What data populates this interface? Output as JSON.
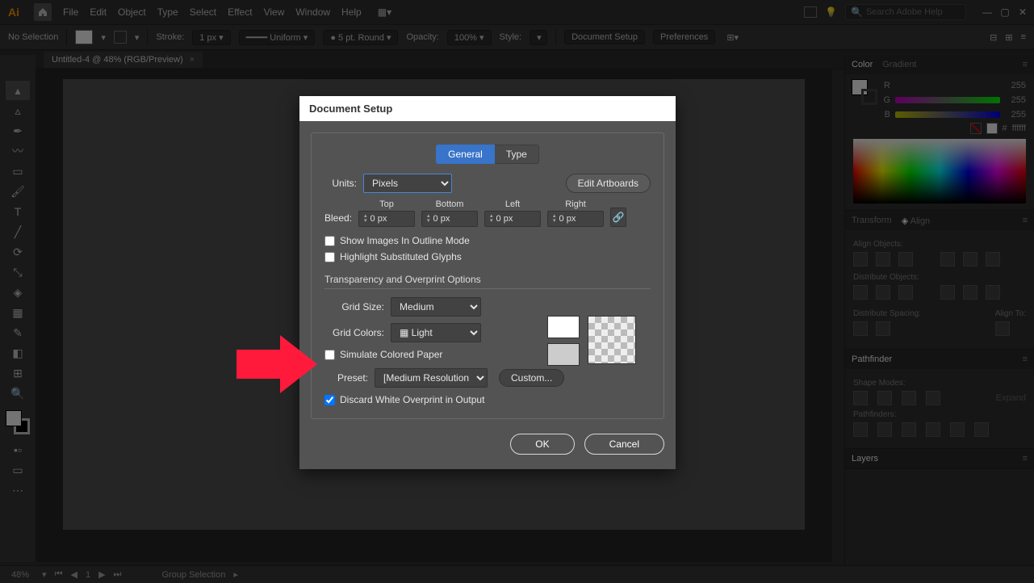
{
  "app": {
    "title": "Ai"
  },
  "menu": [
    "File",
    "Edit",
    "Object",
    "Type",
    "Select",
    "Effect",
    "View",
    "Window",
    "Help"
  ],
  "search_placeholder": "Search Adobe Help",
  "optbar": {
    "selection": "No Selection",
    "stroke_label": "Stroke:",
    "stroke_val": "1 px",
    "stroke_style": "Uniform",
    "brush": "5 pt. Round",
    "opacity_label": "Opacity:",
    "opacity_val": "100%",
    "style_label": "Style:",
    "docsetup": "Document Setup",
    "prefs": "Preferences"
  },
  "doc_tab": "Untitled-4 @ 48% (RGB/Preview)",
  "status": {
    "zoom": "48%",
    "artboard": "1",
    "selinfo": "Group Selection"
  },
  "panels": {
    "color": {
      "tab1": "Color",
      "tab2": "Gradient",
      "channels": [
        {
          "l": "R",
          "v": "255",
          "g": "linear-gradient(to right,#000,#f00)"
        },
        {
          "l": "G",
          "v": "255",
          "g": "linear-gradient(to right,#000,#0f0)"
        },
        {
          "l": "B",
          "v": "255",
          "g": "linear-gradient(to right,#000,#00f)"
        }
      ],
      "hex_prefix": "#",
      "hex": "ffffff"
    },
    "transform": {
      "tab1": "Transform",
      "tab2": "Align"
    },
    "align": {
      "objects": "Align Objects:",
      "distribute": "Distribute Objects:",
      "spacing": "Distribute Spacing:",
      "alignto": "Align To:"
    },
    "pathfinder": {
      "tab": "Pathfinder",
      "shapes": "Shape Modes:",
      "pf": "Pathfinders:",
      "expand": "Expand"
    },
    "layers": {
      "tab": "Layers"
    }
  },
  "dialog": {
    "title": "Document Setup",
    "tabs": {
      "general": "General",
      "type": "Type"
    },
    "units_label": "Units:",
    "units_value": "Pixels",
    "edit_artboards": "Edit Artboards",
    "bleed_label": "Bleed:",
    "bleed": {
      "top": "Top",
      "bottom": "Bottom",
      "left": "Left",
      "right": "Right",
      "value": "0 px"
    },
    "show_outline": "Show Images In Outline Mode",
    "highlight_glyphs": "Highlight Substituted Glyphs",
    "transparency_title": "Transparency and Overprint Options",
    "grid_size_label": "Grid Size:",
    "grid_size_value": "Medium",
    "grid_colors_label": "Grid Colors:",
    "grid_colors_value": "Light",
    "simulate_paper": "Simulate Colored Paper",
    "preset_label": "Preset:",
    "preset_value": "[Medium Resolution]",
    "custom": "Custom...",
    "discard_white": "Discard White Overprint in Output",
    "ok": "OK",
    "cancel": "Cancel"
  }
}
